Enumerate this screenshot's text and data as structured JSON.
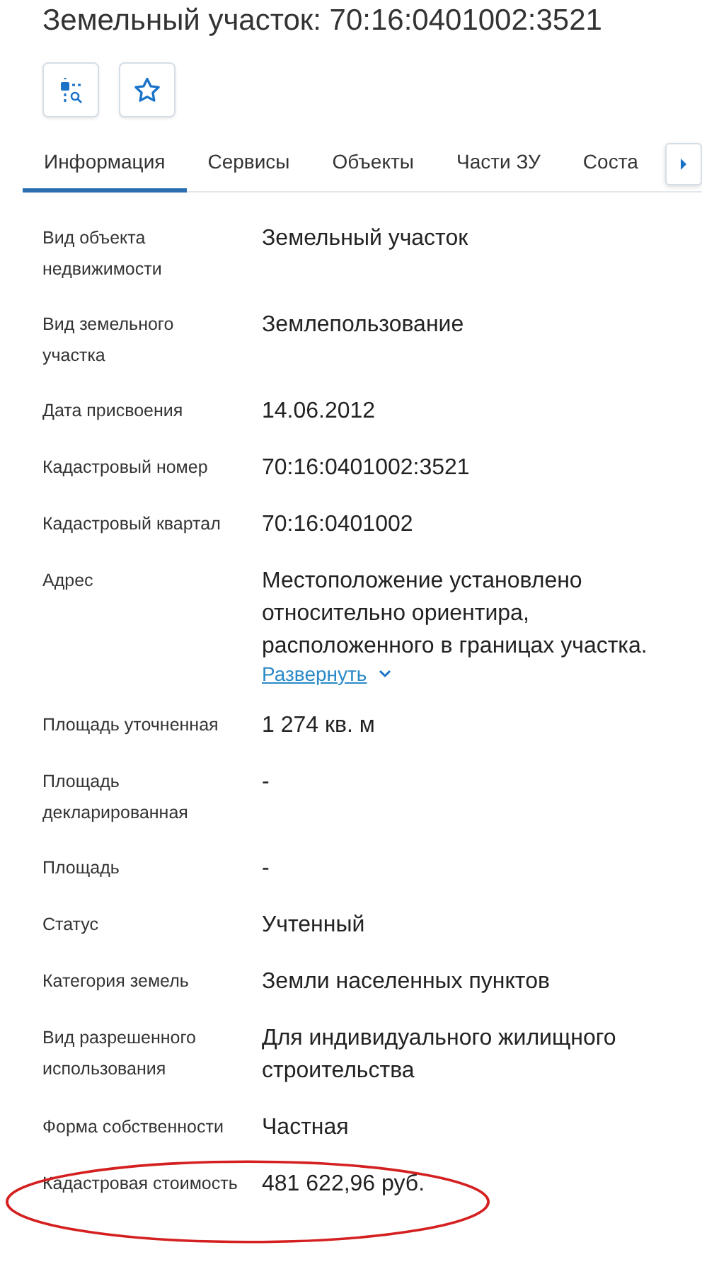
{
  "title": "Земельный участок: 70:16:0401002:3521",
  "tabs": [
    {
      "label": "Информация",
      "selected": true
    },
    {
      "label": "Сервисы",
      "selected": false
    },
    {
      "label": "Объекты",
      "selected": false
    },
    {
      "label": "Части ЗУ",
      "selected": false
    },
    {
      "label": "Соста",
      "selected": false
    }
  ],
  "rows": [
    {
      "label": "Вид объекта недвижимости",
      "value": "Земельный участок"
    },
    {
      "label": "Вид земельного участка",
      "value": "Землепользование"
    },
    {
      "label": "Дата присвоения",
      "value": "14.06.2012"
    },
    {
      "label": "Кадастровый номер",
      "value": "70:16:0401002:3521"
    },
    {
      "label": "Кадастровый квартал",
      "value": "70:16:0401002"
    },
    {
      "label": "Адрес",
      "value": "Местоположение установлено относительно ориентира, расположенного в границах участка.",
      "link": "Развернуть"
    },
    {
      "label": "Площадь уточненная",
      "value": "1 274 кв. м"
    },
    {
      "label": "Площадь декларированная",
      "value": "-"
    },
    {
      "label": "Площадь",
      "value": "-"
    },
    {
      "label": "Статус",
      "value": "Учтенный"
    },
    {
      "label": "Категория земель",
      "value": "Земли населенных пунктов"
    },
    {
      "label": "Вид разрешенного использования",
      "value": "Для индивидуального жилищного строительства"
    },
    {
      "label": "Форма собственности",
      "value": "Частная"
    },
    {
      "label": "Кадастровая стоимость",
      "value": "481 622,96 руб."
    }
  ]
}
